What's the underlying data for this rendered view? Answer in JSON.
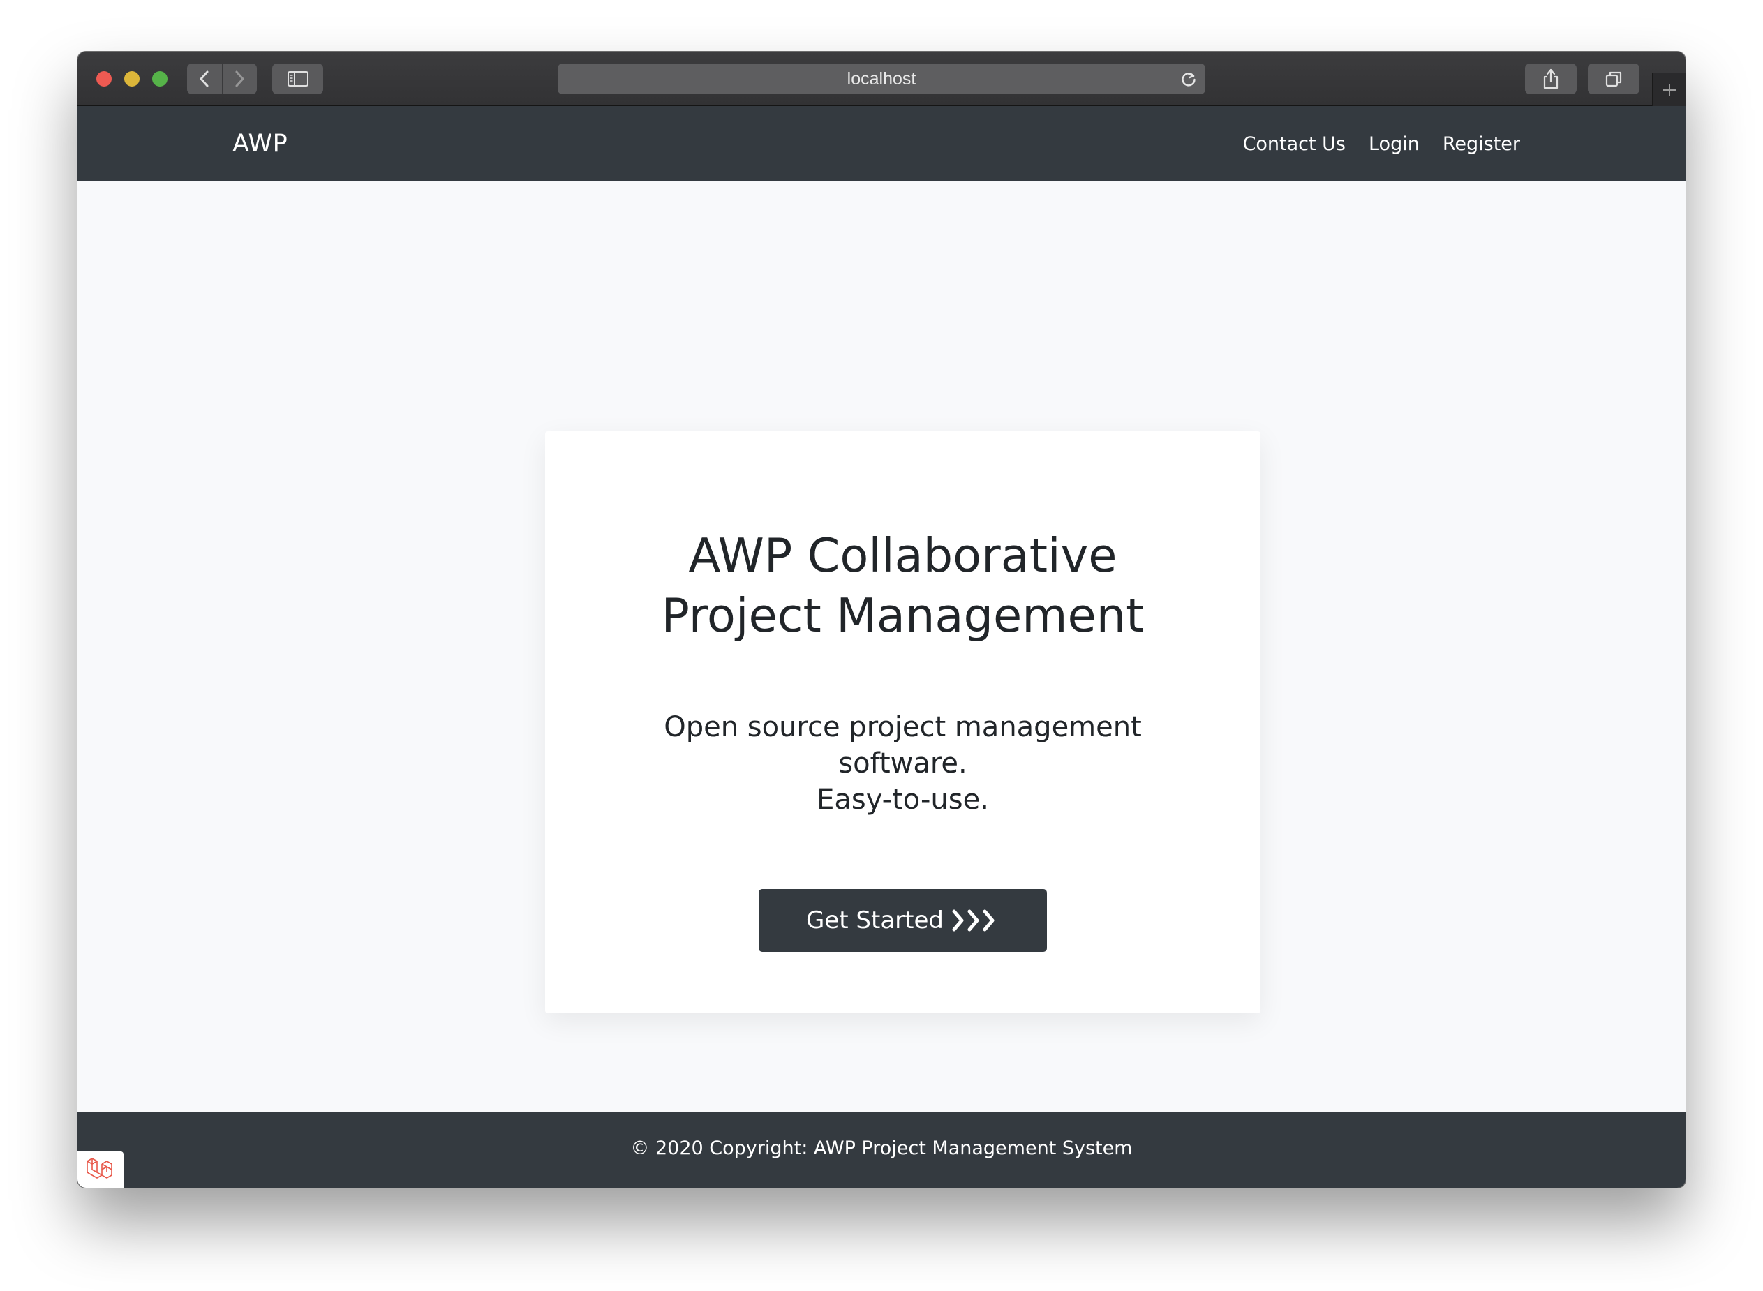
{
  "browser": {
    "url": "localhost",
    "icons": {
      "back": "chevron-left-icon",
      "forward": "chevron-right-icon",
      "sidebar": "sidebar-icon",
      "reload": "reload-icon",
      "share": "share-icon",
      "tabs": "tabs-overview-icon",
      "new_tab": "plus-icon"
    }
  },
  "navbar": {
    "brand": "AWP",
    "links": [
      "Contact Us",
      "Login",
      "Register"
    ]
  },
  "hero": {
    "title_line1": "AWP Collaborative",
    "title_line2": "Project Management",
    "subtitle_line1": "Open source project management",
    "subtitle_line2": "software.",
    "subtitle_line3": "Easy-to-use.",
    "button_label": "Get Started",
    "button_icon": "triple-chevron-right-icon"
  },
  "footer": {
    "text": "© 2020 Copyright: AWP Project Management System",
    "badge_icon": "laravel-logo-icon"
  },
  "colors": {
    "navbar": "#343a40",
    "page_bg": "#f8f9fb",
    "card_bg": "#ffffff",
    "text": "#212529",
    "titlebar": "#363638"
  }
}
